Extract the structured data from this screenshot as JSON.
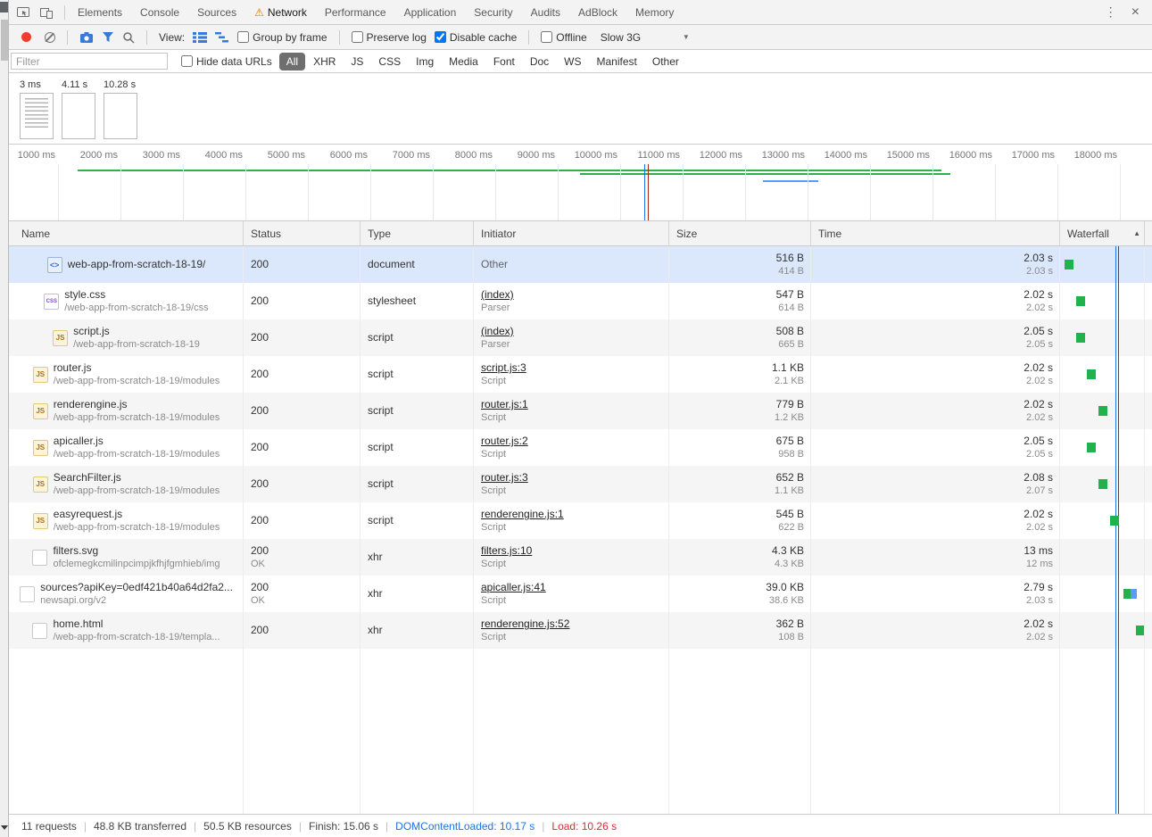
{
  "tab_bar": {
    "tabs": [
      "Elements",
      "Console",
      "Sources",
      "Network",
      "Performance",
      "Application",
      "Security",
      "Audits",
      "AdBlock",
      "Memory"
    ],
    "active_tab": "Network"
  },
  "net_toolbar": {
    "view_label": "View:",
    "group_by_frame": "Group by frame",
    "preserve_log": "Preserve log",
    "disable_cache": "Disable cache",
    "offline": "Offline",
    "throttling": "Slow 3G"
  },
  "filter_bar": {
    "placeholder": "Filter",
    "hide_data_urls": "Hide data URLs",
    "selected_type": "All",
    "types": [
      "All",
      "XHR",
      "JS",
      "CSS",
      "Img",
      "Media",
      "Font",
      "Doc",
      "WS",
      "Manifest",
      "Other"
    ]
  },
  "filmstrip": {
    "frames": [
      {
        "label": "3 ms"
      },
      {
        "label": "4.11 s"
      },
      {
        "label": "10.28 s"
      }
    ]
  },
  "timeline": {
    "ticks": [
      "1000 ms",
      "2000 ms",
      "3000 ms",
      "4000 ms",
      "5000 ms",
      "6000 ms",
      "7000 ms",
      "8000 ms",
      "9000 ms",
      "10000 ms",
      "11000 ms",
      "12000 ms",
      "13000 ms",
      "14000 ms",
      "15000 ms",
      "16000 ms",
      "17000 ms",
      "18000 ms"
    ]
  },
  "table": {
    "columns": [
      "Name",
      "Status",
      "Type",
      "Initiator",
      "Size",
      "Time",
      "Waterfall"
    ],
    "rows": [
      {
        "icon": "doc",
        "name": "web-app-from-scratch-18-19/",
        "path": "",
        "status": "200",
        "status_sub": "",
        "type": "document",
        "initiator": "Other",
        "initiator_link": false,
        "initiator_sub": "",
        "size": "516 B",
        "size_sub": "414 B",
        "time": "2.03 s",
        "time_sub": "2.03 s",
        "selected": true,
        "waterfall": [
          {
            "x": 5,
            "w": 10,
            "color": "green"
          }
        ]
      },
      {
        "icon": "css",
        "name": "style.css",
        "path": "/web-app-from-scratch-18-19/css",
        "status": "200",
        "status_sub": "",
        "type": "stylesheet",
        "initiator": "(index)",
        "initiator_link": true,
        "initiator_sub": "Parser",
        "size": "547 B",
        "size_sub": "614 B",
        "time": "2.02 s",
        "time_sub": "2.02 s",
        "selected": false,
        "waterfall": [
          {
            "x": 18,
            "w": 10,
            "color": "green"
          }
        ]
      },
      {
        "icon": "js",
        "name": "script.js",
        "path": "/web-app-from-scratch-18-19",
        "status": "200",
        "status_sub": "",
        "type": "script",
        "initiator": "(index)",
        "initiator_link": true,
        "initiator_sub": "Parser",
        "size": "508 B",
        "size_sub": "665 B",
        "time": "2.05 s",
        "time_sub": "2.05 s",
        "selected": false,
        "waterfall": [
          {
            "x": 18,
            "w": 10,
            "color": "green"
          }
        ]
      },
      {
        "icon": "js",
        "name": "router.js",
        "path": "/web-app-from-scratch-18-19/modules",
        "status": "200",
        "status_sub": "",
        "type": "script",
        "initiator": "script.js:3",
        "initiator_link": true,
        "initiator_sub": "Script",
        "size": "1.1 KB",
        "size_sub": "2.1 KB",
        "time": "2.02 s",
        "time_sub": "2.02 s",
        "selected": false,
        "waterfall": [
          {
            "x": 30,
            "w": 10,
            "color": "green"
          }
        ]
      },
      {
        "icon": "js",
        "name": "renderengine.js",
        "path": "/web-app-from-scratch-18-19/modules",
        "status": "200",
        "status_sub": "",
        "type": "script",
        "initiator": "router.js:1",
        "initiator_link": true,
        "initiator_sub": "Script",
        "size": "779 B",
        "size_sub": "1.2 KB",
        "time": "2.02 s",
        "time_sub": "2.02 s",
        "selected": false,
        "waterfall": [
          {
            "x": 43,
            "w": 10,
            "color": "green"
          }
        ]
      },
      {
        "icon": "js",
        "name": "apicaller.js",
        "path": "/web-app-from-scratch-18-19/modules",
        "status": "200",
        "status_sub": "",
        "type": "script",
        "initiator": "router.js:2",
        "initiator_link": true,
        "initiator_sub": "Script",
        "size": "675 B",
        "size_sub": "958 B",
        "time": "2.05 s",
        "time_sub": "2.05 s",
        "selected": false,
        "waterfall": [
          {
            "x": 30,
            "w": 10,
            "color": "green"
          }
        ]
      },
      {
        "icon": "js",
        "name": "SearchFilter.js",
        "path": "/web-app-from-scratch-18-19/modules",
        "status": "200",
        "status_sub": "",
        "type": "script",
        "initiator": "router.js:3",
        "initiator_link": true,
        "initiator_sub": "Script",
        "size": "652 B",
        "size_sub": "1.1 KB",
        "time": "2.08 s",
        "time_sub": "2.07 s",
        "selected": false,
        "waterfall": [
          {
            "x": 43,
            "w": 10,
            "color": "green"
          }
        ]
      },
      {
        "icon": "js",
        "name": "easyrequest.js",
        "path": "/web-app-from-scratch-18-19/modules",
        "status": "200",
        "status_sub": "",
        "type": "script",
        "initiator": "renderengine.js:1",
        "initiator_link": true,
        "initiator_sub": "Script",
        "size": "545 B",
        "size_sub": "622 B",
        "time": "2.02 s",
        "time_sub": "2.02 s",
        "selected": false,
        "waterfall": [
          {
            "x": 56,
            "w": 10,
            "color": "green"
          }
        ]
      },
      {
        "icon": "file",
        "name": "filters.svg",
        "path": "ofclemegkcmilinpcimpjkfhjfgmhieb/img",
        "status": "200",
        "status_sub": "OK",
        "type": "xhr",
        "initiator": "filters.js:10",
        "initiator_link": true,
        "initiator_sub": "Script",
        "size": "4.3 KB",
        "size_sub": "4.3 KB",
        "time": "13 ms",
        "time_sub": "12 ms",
        "selected": false,
        "waterfall": []
      },
      {
        "icon": "file",
        "name": "sources?apiKey=0edf421b40a64d2fa2...",
        "path": "newsapi.org/v2",
        "status": "200",
        "status_sub": "OK",
        "type": "xhr",
        "initiator": "apicaller.js:41",
        "initiator_link": true,
        "initiator_sub": "Script",
        "size": "39.0 KB",
        "size_sub": "38.6 KB",
        "time": "2.79 s",
        "time_sub": "2.03 s",
        "selected": false,
        "waterfall": [
          {
            "x": 71,
            "w": 8,
            "color": "green"
          },
          {
            "x": 79,
            "w": 7,
            "color": "blue"
          }
        ]
      },
      {
        "icon": "file",
        "name": "home.html",
        "path": "/web-app-from-scratch-18-19/templa...",
        "status": "200",
        "status_sub": "",
        "type": "xhr",
        "initiator": "renderengine.js:52",
        "initiator_link": true,
        "initiator_sub": "Script",
        "size": "362 B",
        "size_sub": "108 B",
        "time": "2.02 s",
        "time_sub": "2.02 s",
        "selected": false,
        "waterfall": [
          {
            "x": 85,
            "w": 9,
            "color": "green"
          }
        ]
      }
    ]
  },
  "status_bar": {
    "items": [
      {
        "text": "11 requests"
      },
      {
        "text": "48.8 KB transferred"
      },
      {
        "text": "50.5 KB resources"
      },
      {
        "text": "Finish: 15.06 s"
      },
      {
        "text": "DOMContentLoaded: 10.17 s",
        "color": "#1a73e8"
      },
      {
        "text": "Load: 10.26 s",
        "color": "#d32f2f"
      }
    ]
  },
  "colors": {
    "accent_blue": "#3879d9",
    "waterfall_green": "#21b24b",
    "waterfall_blue": "#5b9cf8",
    "load_line_red": "#a52714",
    "dcl_line_blue": "#1a73e8",
    "selected_row": "#dbe7fb",
    "warning_orange": "#e37400"
  }
}
